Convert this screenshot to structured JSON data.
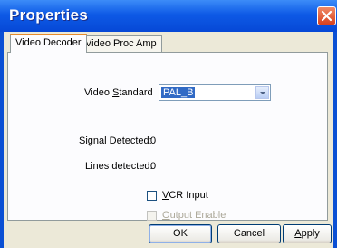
{
  "window": {
    "title": "Properties"
  },
  "tabs": [
    {
      "label": "Video Decoder",
      "active": true
    },
    {
      "label": "Video Proc Amp",
      "active": false
    }
  ],
  "video_standard": {
    "label_prefix": "Video ",
    "label_mnemonic": "S",
    "label_suffix": "tandard",
    "value": "PAL_B"
  },
  "signal_detected": {
    "label": "Signal Detected:",
    "value": "0"
  },
  "lines_detected": {
    "label": "Lines detected:",
    "value": "0"
  },
  "vcr_input": {
    "mnemonic": "V",
    "rest": "CR Input",
    "checked": false
  },
  "output_enable": {
    "mnemonic": "O",
    "rest": "utput Enable",
    "checked": false,
    "enabled": false
  },
  "buttons": {
    "ok": "OK",
    "cancel": "Cancel",
    "apply_mnemonic": "A",
    "apply_rest": "pply"
  }
}
